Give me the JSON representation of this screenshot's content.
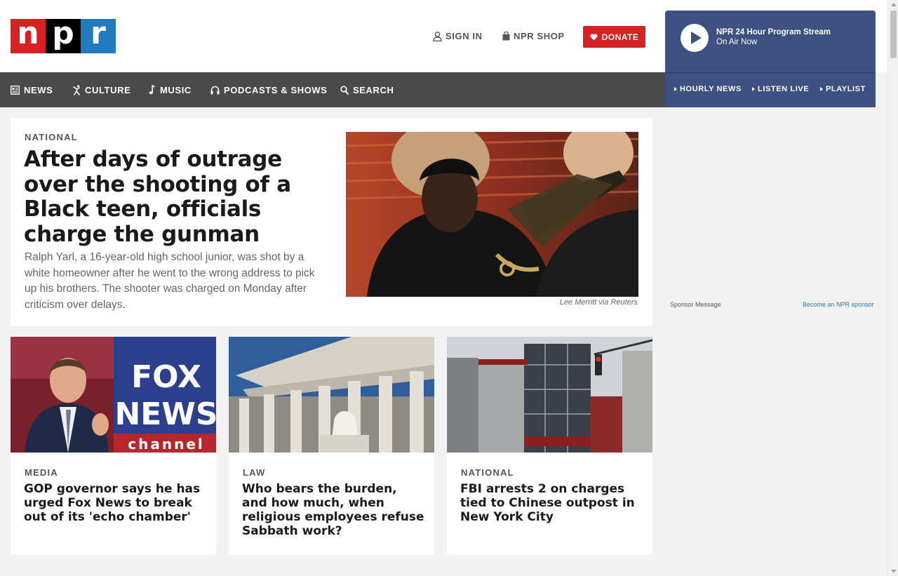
{
  "logo": {
    "letters": [
      "n",
      "p",
      "r"
    ],
    "colors": [
      "#d62021",
      "#000000",
      "#237bbd"
    ]
  },
  "header": {
    "sign_in": "SIGN IN",
    "shop": "NPR SHOP",
    "donate": "DONATE",
    "icons": {
      "sign_in": "user-icon",
      "shop": "shopping-bag-icon",
      "donate": "heart-icon"
    }
  },
  "nav": {
    "items": [
      {
        "label": "NEWS",
        "icon": "newspaper-icon"
      },
      {
        "label": "CULTURE",
        "icon": "dancer-icon"
      },
      {
        "label": "MUSIC",
        "icon": "music-note-icon"
      },
      {
        "label": "PODCASTS & SHOWS",
        "icon": "headphones-icon"
      },
      {
        "label": "SEARCH",
        "icon": "search-icon"
      }
    ]
  },
  "player": {
    "title": "NPR 24 Hour Program Stream",
    "subtitle": "On Air Now",
    "links": [
      "HOURLY NEWS",
      "LISTEN LIVE",
      "PLAYLIST"
    ]
  },
  "featured": {
    "slug": "NATIONAL",
    "headline": "After days of outrage over the shooting of a Black teen, officials charge the gunman",
    "teaser": "Ralph Yarl, a 16-year-old high school junior, was shot by a white homeowner after he went to the wrong address to pick up his brothers. The shooter was charged on Monday after criticism over delays.",
    "photo_credit": "Lee Merritt via Reuters"
  },
  "cards": [
    {
      "slug": "MEDIA",
      "title": "GOP governor says he has urged Fox News to break out of its 'echo chamber'"
    },
    {
      "slug": "LAW",
      "title": "Who bears the burden, and how much, when religious employees refuse Sabbath work?"
    },
    {
      "slug": "NATIONAL",
      "title": "FBI arrests 2 on charges tied to Chinese outpost in New York City"
    }
  ],
  "fox_logo": {
    "line1": "FOX",
    "line2": "NEWS",
    "line3": "channel"
  },
  "sponsor": {
    "label": "Sponsor Message",
    "link": "Become an NPR sponsor"
  },
  "colors": {
    "npr_red": "#d62021",
    "npr_blue": "#237bbd",
    "nav_bg": "#4a4a4a",
    "player_bg": "#3d5082"
  }
}
